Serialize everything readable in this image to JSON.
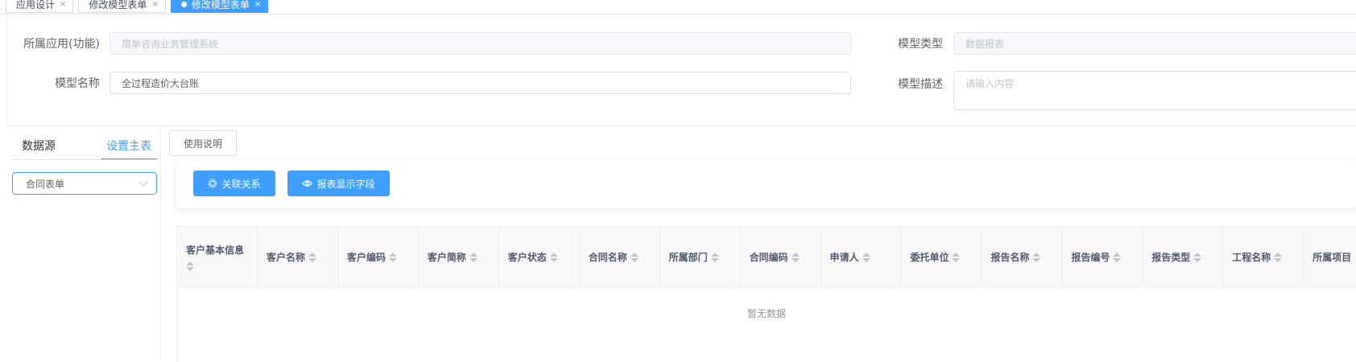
{
  "tabs": [
    {
      "label": "应用设计",
      "close": "×",
      "active": false
    },
    {
      "label": "修改模型表单",
      "close": "×",
      "active": false
    },
    {
      "label": "修改模型表单",
      "close": "×",
      "active": true
    }
  ],
  "form": {
    "app_label": "所属应用(功能)",
    "app_value": "简单咨询业务管理系统",
    "model_type_label": "模型类型",
    "model_type_value": "数据报表",
    "model_name_label": "模型名称",
    "model_name_value": "全过程造价大台账",
    "model_desc_label": "模型描述",
    "model_desc_placeholder": "请输入内容"
  },
  "side": {
    "tab_datasource": "数据源",
    "tab_main_table": "设置主表",
    "select_value": "合同表单"
  },
  "toolbar": {
    "usage_label": "使用说明",
    "relation_label": "关联关系",
    "display_fields_label": "报表显示字段"
  },
  "table": {
    "columns": [
      "客户基本信息",
      "客户名称",
      "客户编码",
      "客户简称",
      "客户状态",
      "合同名称",
      "所属部门",
      "合同编码",
      "申请人",
      "委托单位",
      "报告名称",
      "报告编号",
      "报告类型",
      "工程名称",
      "所属项目"
    ],
    "empty_text": "暂无数据"
  },
  "colors": {
    "accent": "#409eff",
    "border": "#dcdfe6",
    "header_bg": "#f8f8f9"
  }
}
